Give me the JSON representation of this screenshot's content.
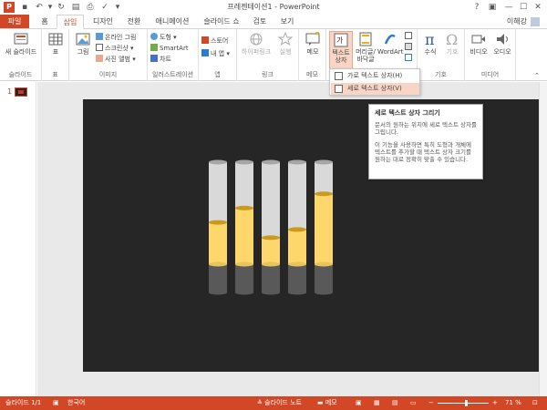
{
  "titlebar": {
    "app_icon": "P",
    "title": "프레젠테이션1 - PowerPoint",
    "qat": [
      {
        "icon": "save-icon",
        "glyph": "▪"
      },
      {
        "icon": "undo-icon",
        "glyph": "↶"
      },
      {
        "icon": "redo-icon",
        "glyph": "↻"
      },
      {
        "icon": "present-icon",
        "glyph": "▤"
      },
      {
        "icon": "print-icon",
        "glyph": "⎙"
      },
      {
        "icon": "spell-icon",
        "glyph": "✓"
      },
      {
        "icon": "customize-icon",
        "glyph": "▾"
      }
    ],
    "controls": {
      "help": "?",
      "ribbon_options": "▣",
      "minimize": "—",
      "maximize": "☐",
      "close": "✕"
    }
  },
  "tabs": [
    "파일",
    "홈",
    "삽입",
    "디자인",
    "전환",
    "애니메이션",
    "슬라이드 쇼",
    "검토",
    "보기"
  ],
  "active_tab": "삽입",
  "user_name": "이해강",
  "ribbon": {
    "groups": {
      "slides": {
        "label": "슬라이드",
        "new_slide": "새 슬라이드"
      },
      "tables": {
        "label": "표",
        "table": "표"
      },
      "images": {
        "label": "이미지",
        "picture": "그림",
        "online_picture": "온라인 그림",
        "screenshot": "스크린샷",
        "photo_album": "사진 앨범"
      },
      "illustrations": {
        "label": "일러스트레이션",
        "shapes": "도형",
        "smartart": "SmartArt",
        "chart": "차트"
      },
      "apps": {
        "label": "앱",
        "store": "스토어",
        "my_apps": "내 앱"
      },
      "links": {
        "label": "링크",
        "hyperlink": "하이퍼링크",
        "action": "실행"
      },
      "comments": {
        "label": "메모",
        "comment": "메모"
      },
      "text": {
        "label": "",
        "textbox": "텍스트 상자",
        "header_footer": "머리글/ 바닥글",
        "wordart": "WordArt"
      },
      "symbols": {
        "label": "기호",
        "equation": "수식",
        "symbol": "기호"
      },
      "media": {
        "label": "미디어",
        "video": "비디오",
        "audio": "오디오"
      }
    }
  },
  "textbox_dropdown": {
    "items": [
      {
        "label": "가로 텍스트 상자(H)",
        "highlighted": false
      },
      {
        "label": "세로 텍스트 상자(V)",
        "highlighted": true
      }
    ]
  },
  "tooltip": {
    "title": "세로 텍스트 상자 그리기",
    "body1": "문서의 원하는 위치에 세로 텍스트 상자를 그립니다.",
    "body2": "이 기능을 사용하면 특히 도형과 개체에 텍스트를 추가할 때 텍스트 상자 크기를 원하는 대로 정확히 맞출 수 있습니다."
  },
  "thumbnail_pane": {
    "slide_number": "1"
  },
  "slide": {
    "background": "#262626",
    "cylinders": [
      {
        "fill_level": 0.41
      },
      {
        "fill_level": 0.55
      },
      {
        "fill_level": 0.26
      },
      {
        "fill_level": 0.34
      },
      {
        "fill_level": 0.69
      }
    ]
  },
  "statusbar": {
    "slide_info": "슬라이드 1/1",
    "language": "한국어",
    "notes": "슬라이드 노트",
    "comments": "메모",
    "zoom": "71 %",
    "zoom_fraction": 0.55
  },
  "colors": {
    "accent": "#d24726",
    "ribbon_bg": "#ffffff",
    "slide_bg": "#262626",
    "cylinder_fill": "#fdd76b",
    "cylinder_empty": "#d9d9d9",
    "cylinder_base": "#595959"
  }
}
